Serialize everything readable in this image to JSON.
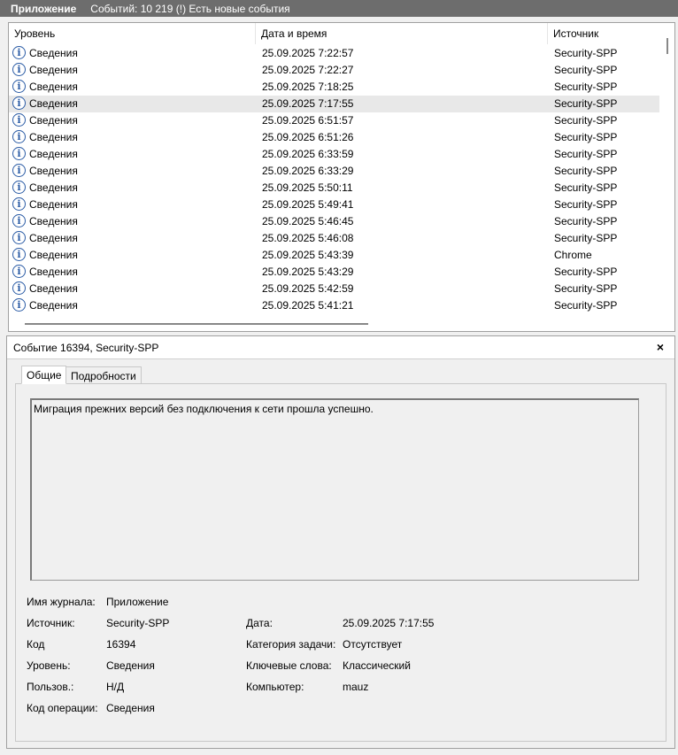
{
  "titlebar": {
    "title": "Приложение",
    "event_count": "Событий: 10 219 (!) Есть новые события"
  },
  "columns": {
    "level": "Уровень",
    "datetime": "Дата и время",
    "source": "Источник"
  },
  "rows": [
    {
      "level": "Сведения",
      "datetime": "25.09.2025 7:22:57",
      "source": "Security-SPP"
    },
    {
      "level": "Сведения",
      "datetime": "25.09.2025 7:22:27",
      "source": "Security-SPP"
    },
    {
      "level": "Сведения",
      "datetime": "25.09.2025 7:18:25",
      "source": "Security-SPP"
    },
    {
      "level": "Сведения",
      "datetime": "25.09.2025 7:17:55",
      "source": "Security-SPP"
    },
    {
      "level": "Сведения",
      "datetime": "25.09.2025 6:51:57",
      "source": "Security-SPP"
    },
    {
      "level": "Сведения",
      "datetime": "25.09.2025 6:51:26",
      "source": "Security-SPP"
    },
    {
      "level": "Сведения",
      "datetime": "25.09.2025 6:33:59",
      "source": "Security-SPP"
    },
    {
      "level": "Сведения",
      "datetime": "25.09.2025 6:33:29",
      "source": "Security-SPP"
    },
    {
      "level": "Сведения",
      "datetime": "25.09.2025 5:50:11",
      "source": "Security-SPP"
    },
    {
      "level": "Сведения",
      "datetime": "25.09.2025 5:49:41",
      "source": "Security-SPP"
    },
    {
      "level": "Сведения",
      "datetime": "25.09.2025 5:46:45",
      "source": "Security-SPP"
    },
    {
      "level": "Сведения",
      "datetime": "25.09.2025 5:46:08",
      "source": "Security-SPP"
    },
    {
      "level": "Сведения",
      "datetime": "25.09.2025 5:43:39",
      "source": "Chrome"
    },
    {
      "level": "Сведения",
      "datetime": "25.09.2025 5:43:29",
      "source": "Security-SPP"
    },
    {
      "level": "Сведения",
      "datetime": "25.09.2025 5:42:59",
      "source": "Security-SPP"
    },
    {
      "level": "Сведения",
      "datetime": "25.09.2025 5:41:21",
      "source": "Security-SPP"
    }
  ],
  "icons": {
    "row_level": "info-icon",
    "close": "close-icon"
  },
  "colors": {
    "titlebar_bg": "#6d6d6d",
    "info_icon": "#2a5ba5",
    "selected_row": "#e8e8e8"
  },
  "detail": {
    "title": "Событие 16394, Security-SPP",
    "close_label": "×",
    "tabs": [
      "Общие",
      "Подробности"
    ],
    "description": "Миграция прежних версий без подключения к сети прошла успешно.",
    "fields": {
      "log_name_label": "Имя журнала:",
      "log_name": "Приложение",
      "source_label": "Источник:",
      "source": "Security-SPP",
      "date_label": "Дата:",
      "date": "25.09.2025 7:17:55",
      "code_label": "Код",
      "code": "16394",
      "category_label": "Категория задачи:",
      "category": "Отсутствует",
      "level_label": "Уровень:",
      "level": "Сведения",
      "keywords_label": "Ключевые слова:",
      "keywords": "Классический",
      "user_label": "Пользов.:",
      "user": "Н/Д",
      "computer_label": "Компьютер:",
      "computer": "mauz",
      "opcode_label": "Код операции:",
      "opcode": "Сведения"
    }
  }
}
